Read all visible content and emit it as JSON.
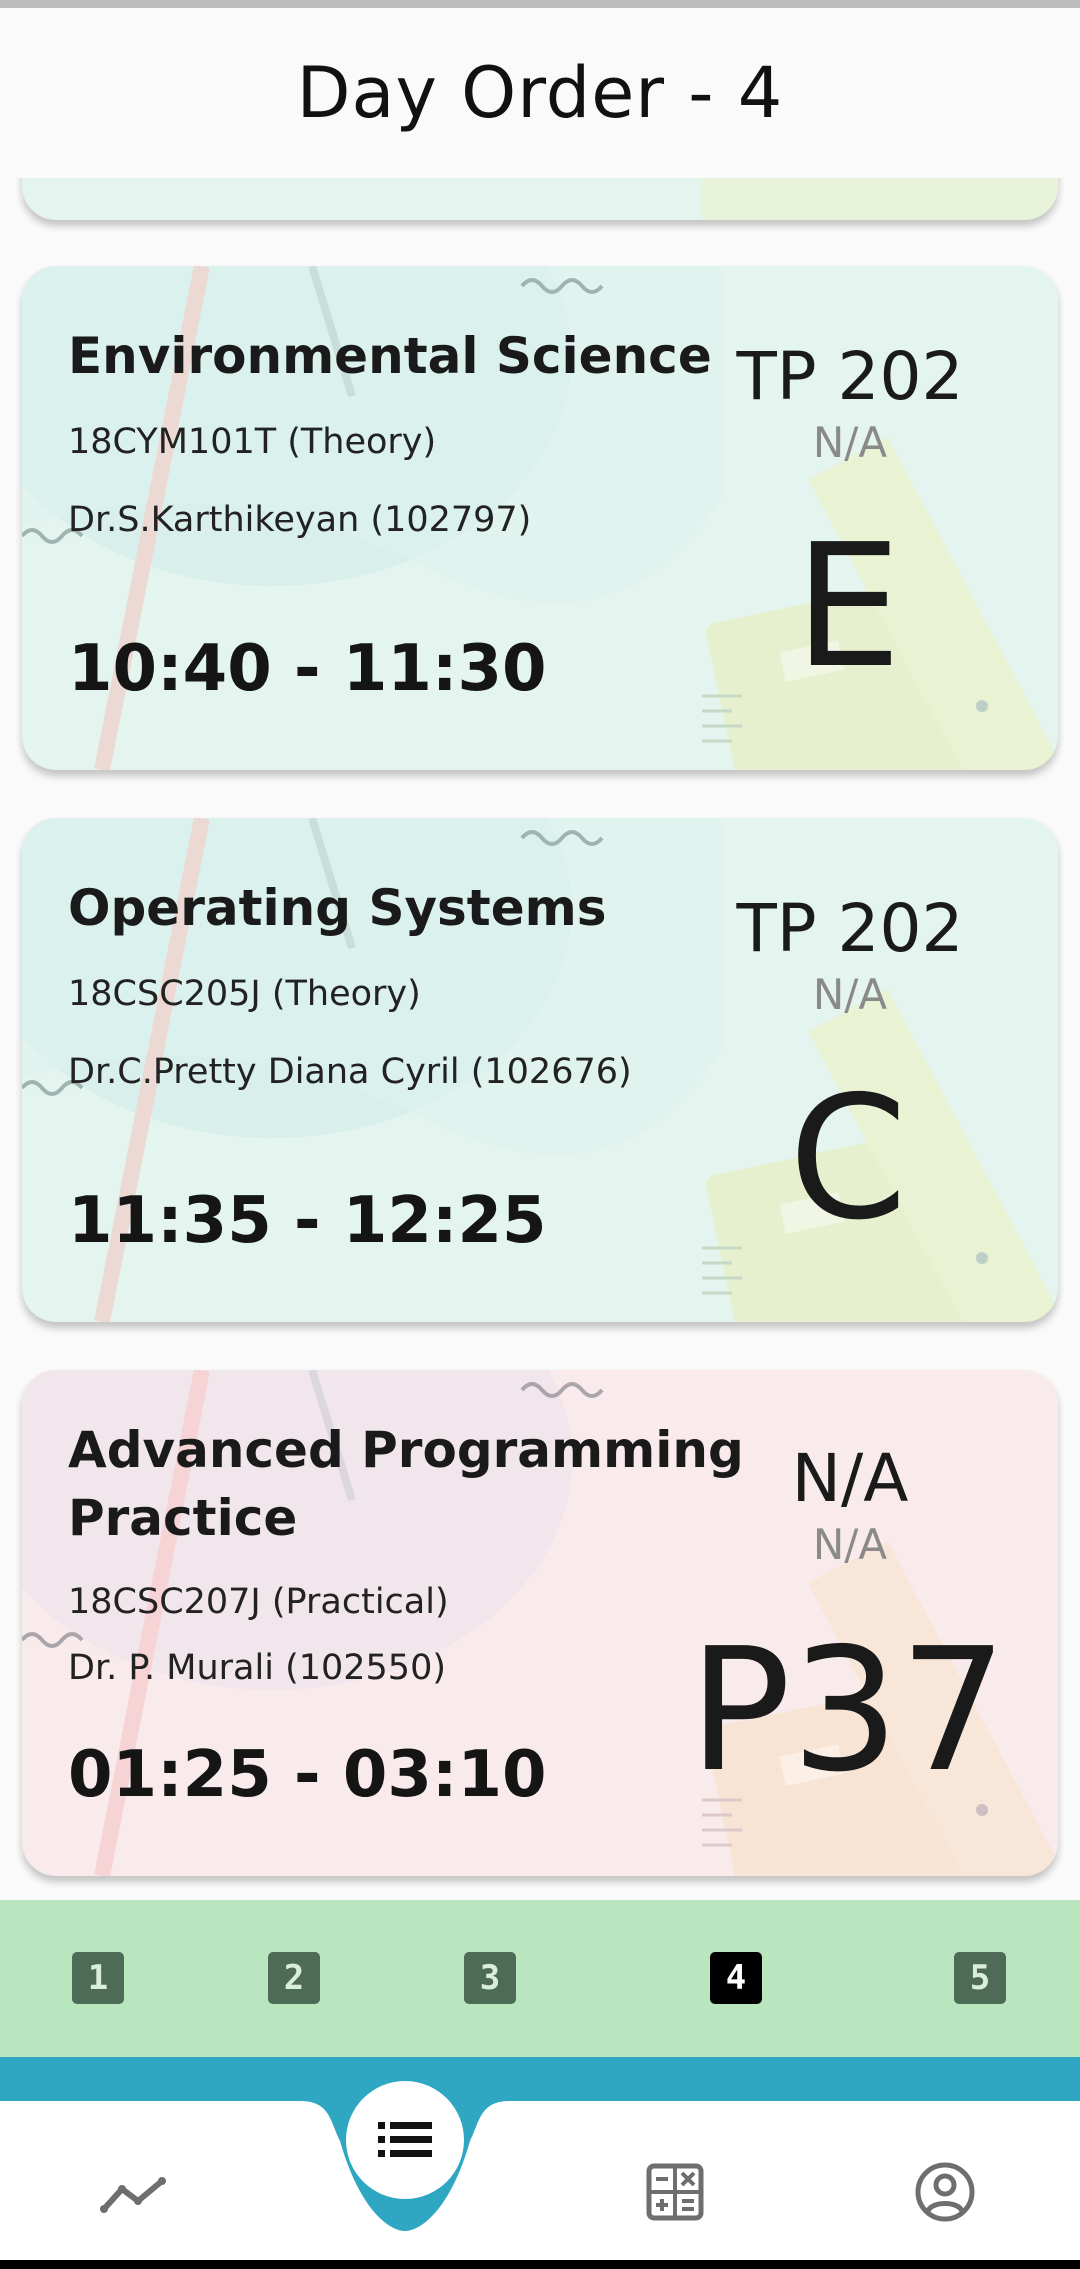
{
  "header": {
    "title": "Day Order - 4"
  },
  "cards": [
    {
      "title": "Environmental Science",
      "code": "18CYM101T (Theory)",
      "teacher": "Dr.S.Karthikeyan (102797)",
      "time": "10:40 - 11:30",
      "room": "TP 202",
      "room_sub": "N/A",
      "slot": "E",
      "color": "#e3f5ee"
    },
    {
      "title": "Operating Systems",
      "code": "18CSC205J (Theory)",
      "teacher": "Dr.C.Pretty Diana Cyril (102676)",
      "time": "11:35 - 12:25",
      "room": "TP 202",
      "room_sub": "N/A",
      "slot": "C",
      "color": "#e3f5ee"
    },
    {
      "title": "Advanced Programming Practice",
      "code": "18CSC207J (Practical)",
      "teacher": "Dr. P. Murali (102550)",
      "time": "01:25 - 03:10",
      "room": "N/A",
      "room_sub": "N/A",
      "slot": "P37",
      "color": "#f9eaec"
    }
  ],
  "day_selector": {
    "days": [
      "1",
      "2",
      "3",
      "4",
      "5"
    ],
    "selected": "4",
    "background": "#b9e5bf"
  },
  "bottom_nav": {
    "items": [
      "trend-icon",
      "list-icon",
      "calculator-icon",
      "account-icon"
    ],
    "active": "list-icon",
    "accent": "#2fa7c3"
  }
}
